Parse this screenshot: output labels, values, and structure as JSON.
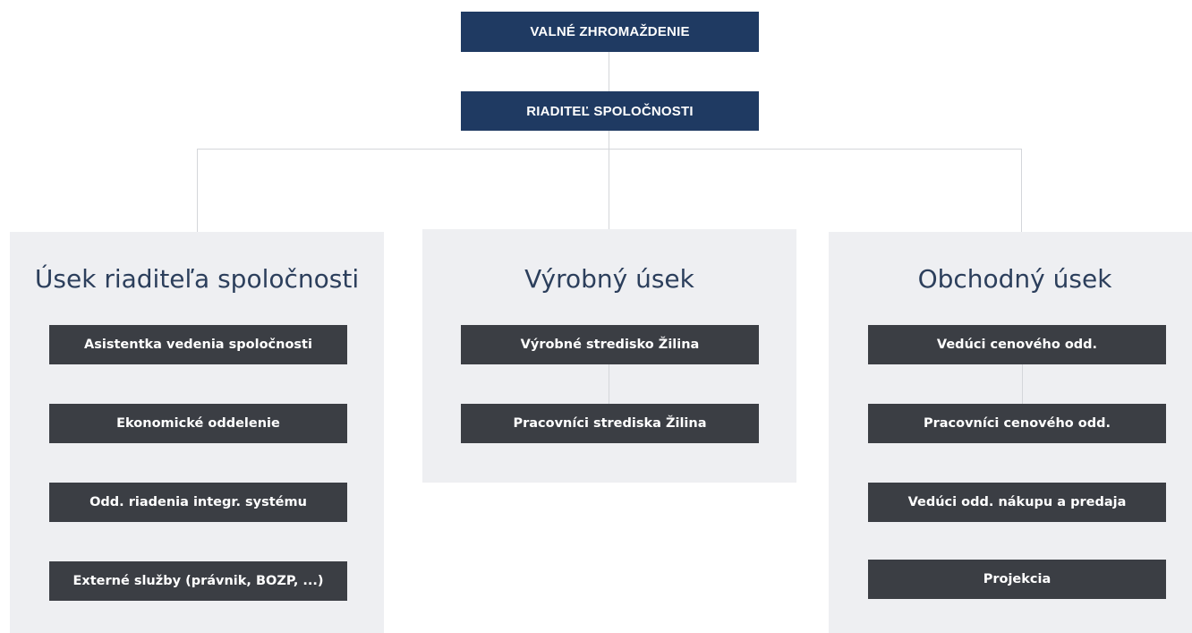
{
  "top": {
    "general_assembly": "VALNÉ ZHROMAŽDENIE",
    "director": "RIADITEĽ SPOLOČNOSTI"
  },
  "divisions": [
    {
      "title": "Úsek riaditeľa spoločnosti",
      "units": [
        "Asistentka vedenia spoločnosti",
        "Ekonomické oddelenie",
        "Odd. riadenia integr. systému",
        "Externé služby (právnik, BOZP, ...)"
      ]
    },
    {
      "title": "Výrobný úsek",
      "units": [
        "Výrobné stredisko Žilina",
        "Pracovníci strediska Žilina"
      ]
    },
    {
      "title": "Obchodný úsek",
      "units": [
        "Vedúci cenového odd.",
        "Pracovníci cenového odd.",
        "Vedúci odd. nákupu a predaja",
        "Projekcia"
      ]
    }
  ],
  "colors": {
    "top_box": "#1f3a62",
    "unit_box": "#3b3e44",
    "panel": "#eeeff2",
    "connector": "#d4d6da",
    "panel_title": "#2c3f5c"
  }
}
